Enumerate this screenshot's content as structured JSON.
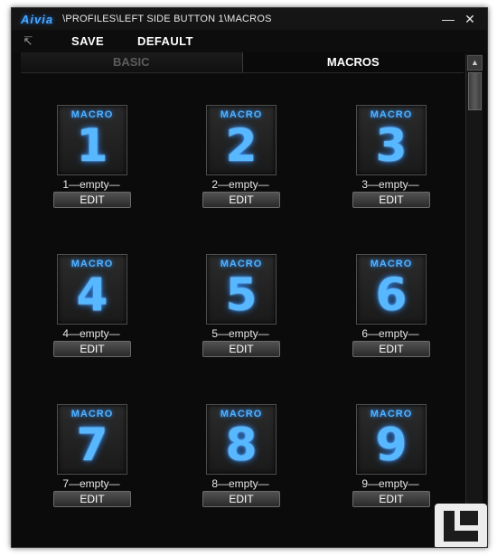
{
  "window": {
    "logo": "Aivia",
    "path": "\\PROFILES\\LEFT SIDE BUTTON 1\\MACROS",
    "minimize_glyph": "—",
    "close_glyph": "✕"
  },
  "menubar": {
    "back_icon": "back-arrow-icon",
    "save_label": "SAVE",
    "default_label": "DEFAULT"
  },
  "tabs": [
    {
      "label": "BASIC",
      "active": false
    },
    {
      "label": "MACROS",
      "active": true
    }
  ],
  "scrollbar": {
    "up_glyph": "▲"
  },
  "macro_tile_word": "MACRO",
  "macros": [
    {
      "number": "1",
      "label": "1—empty—",
      "button": "EDIT"
    },
    {
      "number": "2",
      "label": "2—empty—",
      "button": "EDIT"
    },
    {
      "number": "3",
      "label": "3—empty—",
      "button": "EDIT"
    },
    {
      "number": "4",
      "label": "4—empty—",
      "button": "EDIT"
    },
    {
      "number": "5",
      "label": "5—empty—",
      "button": "EDIT"
    },
    {
      "number": "6",
      "label": "6—empty—",
      "button": "EDIT"
    },
    {
      "number": "7",
      "label": "7—empty—",
      "button": "EDIT"
    },
    {
      "number": "8",
      "label": "8—empty—",
      "button": "EDIT"
    },
    {
      "number": "9",
      "label": "9—empty—",
      "button": "EDIT"
    }
  ],
  "colors": {
    "accent_blue": "#4fb2ff",
    "background": "#0b0b0b"
  }
}
